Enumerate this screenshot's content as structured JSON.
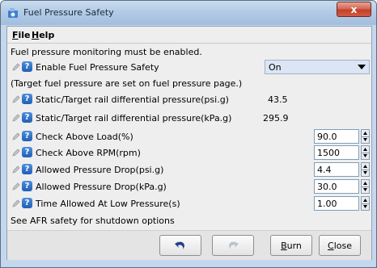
{
  "window": {
    "title": "Fuel Pressure Safety",
    "close_glyph": "x"
  },
  "menu": {
    "file": "File",
    "file_mnemonic": "F",
    "file_rest": "ile",
    "help": "Help",
    "help_mnemonic": "H",
    "help_rest": "elp"
  },
  "notes": {
    "monitoring": "Fuel pressure monitoring must be enabled.",
    "target_note": "(Target fuel pressure are set on fuel pressure page.)",
    "afr_note": "See AFR safety for shutdown options"
  },
  "fields": {
    "enable": {
      "label": "Enable Fuel Pressure Safety",
      "value": "On"
    },
    "static_psi": {
      "label": "Static/Target rail differential pressure(psi.g)",
      "value": "43.5"
    },
    "static_kpa": {
      "label": "Static/Target rail differential pressure(kPa.g)",
      "value": "295.9"
    },
    "check_load": {
      "label": "Check Above Load(%)",
      "value": "90.0"
    },
    "check_rpm": {
      "label": "Check Above RPM(rpm)",
      "value": "1500"
    },
    "drop_psi": {
      "label": "Allowed Pressure Drop(psi.g)",
      "value": "4.4"
    },
    "drop_kpa": {
      "label": "Allowed Pressure Drop(kPa.g)",
      "value": "30.0"
    },
    "time_low": {
      "label": "Time Allowed At Low Pressure(s)",
      "value": "1.00"
    }
  },
  "buttons": {
    "undo_icon": "undo-icon",
    "redo_icon": "redo-icon",
    "burn_mnemonic": "B",
    "burn_rest": "urn",
    "close_mnemonic": "C",
    "close_rest": "lose"
  },
  "colors": {
    "help_icon": "#1f5fb6",
    "combo_bg": "#dbe5f3",
    "close_button": "#c2402a"
  }
}
